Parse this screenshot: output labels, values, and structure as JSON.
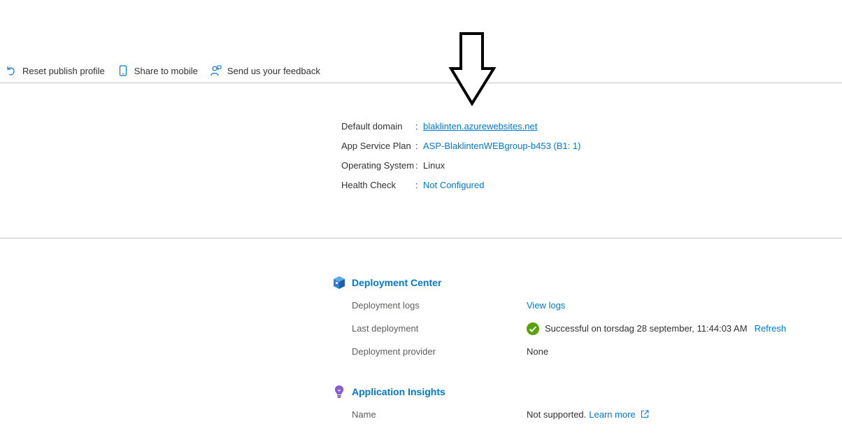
{
  "toolbar": {
    "reset_label": "Reset publish profile",
    "share_label": "Share to mobile",
    "feedback_label": "Send us your feedback"
  },
  "essentials": {
    "default_domain": {
      "label": "Default domain",
      "value": "blaklinten.azurewebsites.net"
    },
    "app_service_plan": {
      "label": "App Service Plan",
      "value": "ASP-BlaklintenWEBgroup-b453 (B1: 1)"
    },
    "operating_system": {
      "label": "Operating System",
      "value": "Linux"
    },
    "health_check": {
      "label": "Health Check",
      "value": "Not Configured"
    },
    "separator": ":"
  },
  "deployment_center": {
    "title": "Deployment Center",
    "logs": {
      "label": "Deployment logs",
      "value": "View logs"
    },
    "last": {
      "label": "Last deployment",
      "value": "Successful on torsdag 28 september, 11:44:03 AM",
      "action": "Refresh"
    },
    "provider": {
      "label": "Deployment provider",
      "value": "None"
    }
  },
  "app_insights": {
    "title": "Application Insights",
    "name": {
      "label": "Name",
      "value": "Not supported.",
      "link": "Learn more"
    }
  },
  "colors": {
    "link": "#0078d4",
    "success": "#57a300",
    "divider": "#c8c6c4"
  },
  "icons": {
    "reset": "undo-icon",
    "share": "mobile-phone-icon",
    "feedback": "feedback-person-icon",
    "deployment": "deployment-cube-icon",
    "insights": "lightbulb-icon",
    "success": "checkmark-circle-icon",
    "external": "external-link-icon",
    "annotation": "down-arrow-icon"
  }
}
